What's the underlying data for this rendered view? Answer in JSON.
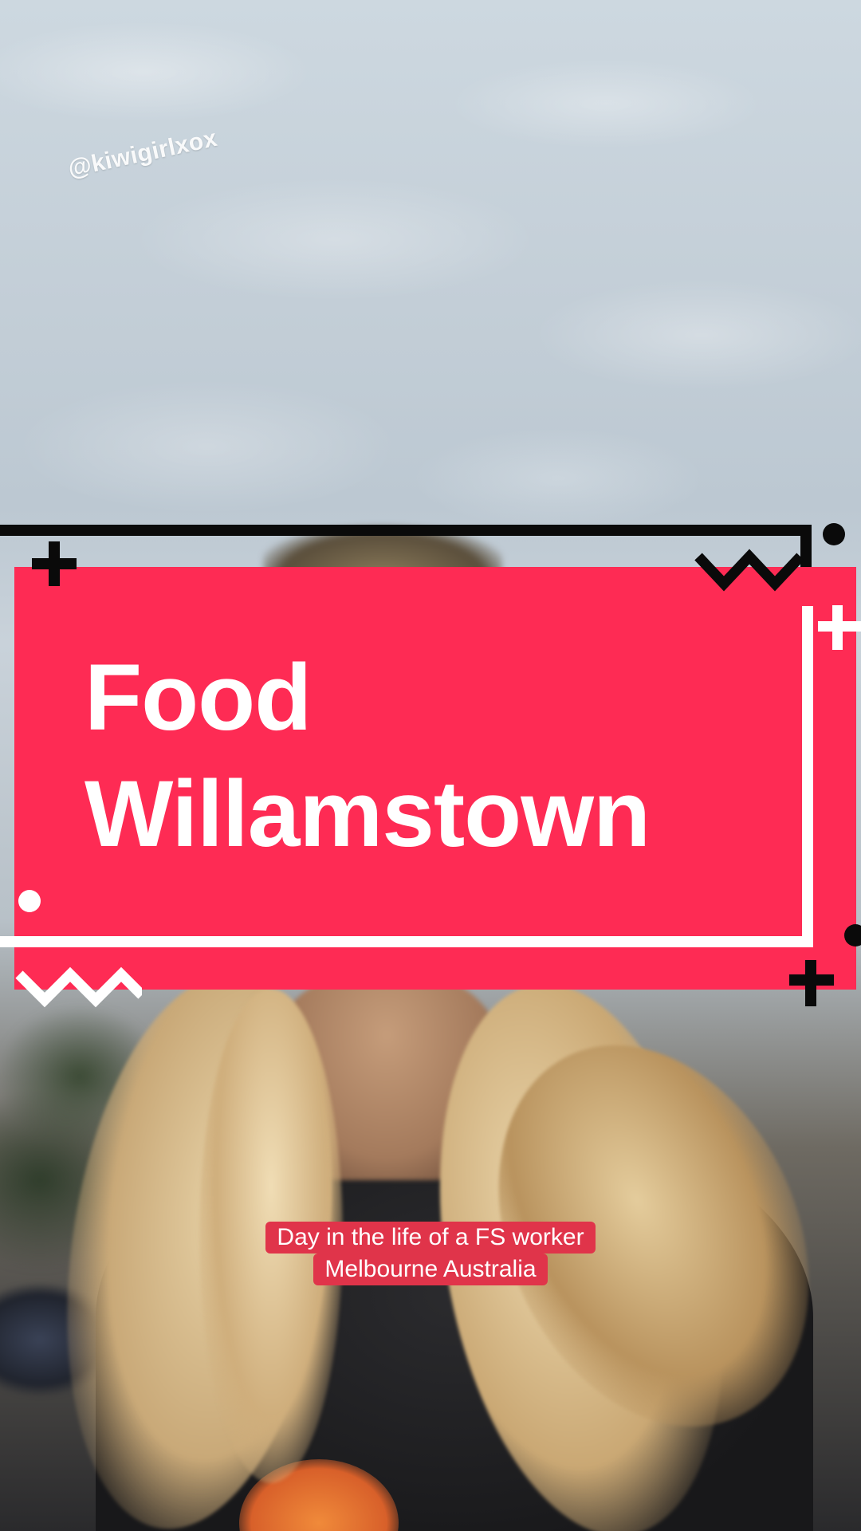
{
  "watermark": {
    "handle": "@kiwigirlxox"
  },
  "title_card": {
    "line1": "Food",
    "line2": "Willamstown",
    "colors": {
      "card": "#fe2b54",
      "frame_dark": "#0a0a0a",
      "frame_light": "#ffffff",
      "text": "#ffffff"
    }
  },
  "caption": {
    "line1": "Day in the life of a FS worker",
    "line2": "Melbourne Australia",
    "background": "#e0344a"
  },
  "decorations": {
    "top_left": "plus-icon",
    "top_right": "zigzag-icon",
    "right_top": "plus-icon",
    "left_mid": "dot-icon",
    "bottom_left": "zigzag-icon",
    "bottom_right": "plus-icon"
  }
}
